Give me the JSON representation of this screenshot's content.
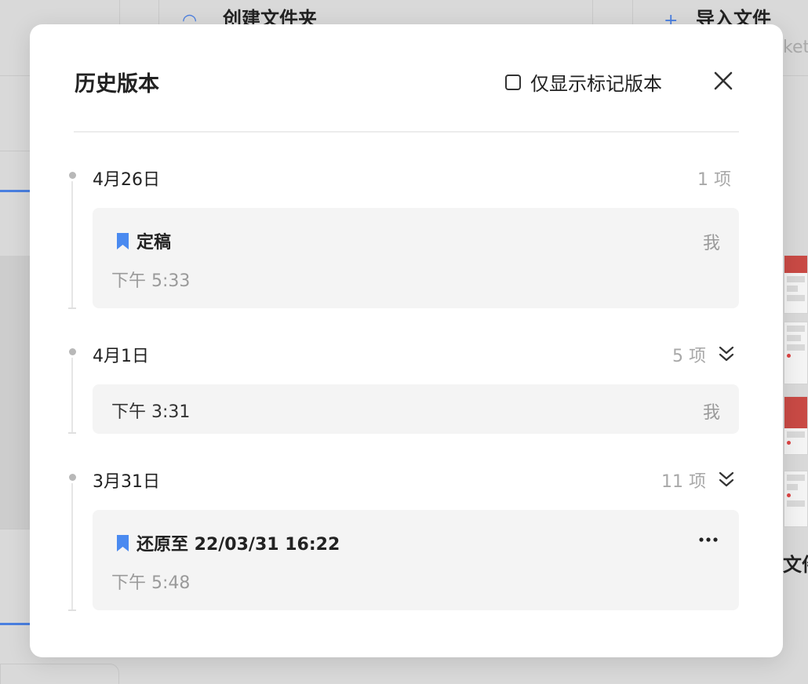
{
  "background": {
    "create_folder_label": "创建文件夹",
    "import_file_label": "导入文件",
    "sub_fragment": "ket",
    "side_fragment": "文件"
  },
  "dialog": {
    "title": "历史版本",
    "filter_label": "仅显示标记版本",
    "filter_checked": false,
    "close_icon": "close-icon"
  },
  "groups": [
    {
      "date": "4月26日",
      "count": "1 项",
      "expandable": false,
      "entries": [
        {
          "title": "定稿",
          "bookmarked": true,
          "time": "下午 5:33",
          "author": "我"
        }
      ]
    },
    {
      "date": "4月1日",
      "count": "5 项",
      "expandable": true,
      "entries": [
        {
          "title": "",
          "bookmarked": false,
          "time": "下午 3:31",
          "author": "我"
        }
      ]
    },
    {
      "date": "3月31日",
      "count": "11 项",
      "expandable": true,
      "entries": [
        {
          "title": "还原至 22/03/31 16:22",
          "bookmarked": true,
          "time": "下午 5:48",
          "author": "",
          "has_more_menu": true
        }
      ]
    }
  ],
  "colors": {
    "bookmark": "#4a8af0",
    "card_bg": "#f4f4f4",
    "muted_text": "#9a9a9a"
  }
}
